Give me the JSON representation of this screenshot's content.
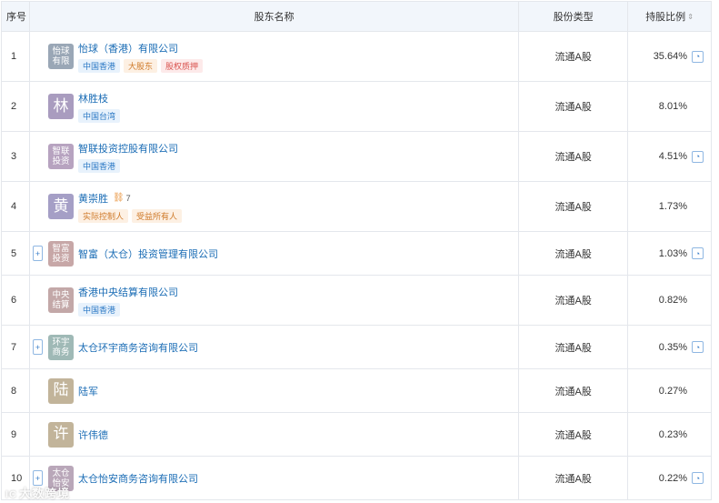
{
  "header": {
    "idx": "序号",
    "name": "股东名称",
    "type": "股份类型",
    "pct": "持股比例"
  },
  "colors": {
    "link": "#1a6cb5",
    "border": "#e4e7ec",
    "header_bg": "#f2f6fb"
  },
  "rows": [
    {
      "idx": "1",
      "avatar": "怡球\n有限",
      "avatar_color": "#9aa7b6",
      "name": "怡球（香港）有限公司",
      "tags": [
        {
          "t": "中国香港",
          "c": "blue"
        },
        {
          "t": "大股东",
          "c": "orange"
        },
        {
          "t": "股权质押",
          "c": "red"
        }
      ],
      "type": "流通A股",
      "pct": "35.64%",
      "chart_icon": true,
      "expand": false
    },
    {
      "idx": "2",
      "avatar": "林",
      "avatar_color": "#a99cbf",
      "name": "林胜枝",
      "tags": [
        {
          "t": "中国台湾",
          "c": "blue"
        }
      ],
      "type": "流通A股",
      "pct": "8.01%",
      "chart_icon": false,
      "expand": false
    },
    {
      "idx": "3",
      "avatar": "智联\n投资",
      "avatar_color": "#b7a3c0",
      "name": "智联投资控股有限公司",
      "tags": [
        {
          "t": "中国香港",
          "c": "blue"
        }
      ],
      "type": "流通A股",
      "pct": "4.51%",
      "chart_icon": true,
      "expand": false
    },
    {
      "idx": "4",
      "avatar": "黄",
      "avatar_color": "#a59fc6",
      "name": "黄崇胜",
      "ctrl": "7",
      "tags": [
        {
          "t": "实际控制人",
          "c": "orange"
        },
        {
          "t": "受益所有人",
          "c": "orange"
        }
      ],
      "type": "流通A股",
      "pct": "1.73%",
      "chart_icon": false,
      "expand": false
    },
    {
      "idx": "5",
      "avatar": "智富\n投资",
      "avatar_color": "#c7a7a7",
      "name": "智富（太仓）投资管理有限公司",
      "tags": [],
      "type": "流通A股",
      "pct": "1.03%",
      "chart_icon": true,
      "expand": true
    },
    {
      "idx": "6",
      "avatar": "中央\n结算",
      "avatar_color": "#c3a8a8",
      "name": "香港中央结算有限公司",
      "tags": [
        {
          "t": "中国香港",
          "c": "blue"
        }
      ],
      "type": "流通A股",
      "pct": "0.82%",
      "chart_icon": false,
      "expand": false
    },
    {
      "idx": "7",
      "avatar": "环宇\n商务",
      "avatar_color": "#9fb9b6",
      "name": "太仓环宇商务咨询有限公司",
      "tags": [],
      "type": "流通A股",
      "pct": "0.35%",
      "chart_icon": true,
      "expand": true
    },
    {
      "idx": "8",
      "avatar": "陆",
      "avatar_color": "#c2b49a",
      "name": "陆军",
      "tags": [],
      "type": "流通A股",
      "pct": "0.27%",
      "chart_icon": false,
      "expand": false
    },
    {
      "idx": "9",
      "avatar": "许",
      "avatar_color": "#c2b49a",
      "name": "许伟德",
      "tags": [],
      "type": "流通A股",
      "pct": "0.23%",
      "chart_icon": false,
      "expand": false
    },
    {
      "idx": "10",
      "avatar": "太仓\n怡安",
      "avatar_color": "#b9a7b9",
      "name": "太仓怡安商务咨询有限公司",
      "tags": [],
      "type": "流通A股",
      "pct": "0.22%",
      "chart_icon": true,
      "expand": true
    }
  ],
  "watermark": "大数跨境",
  "watermark_logo": "IC"
}
